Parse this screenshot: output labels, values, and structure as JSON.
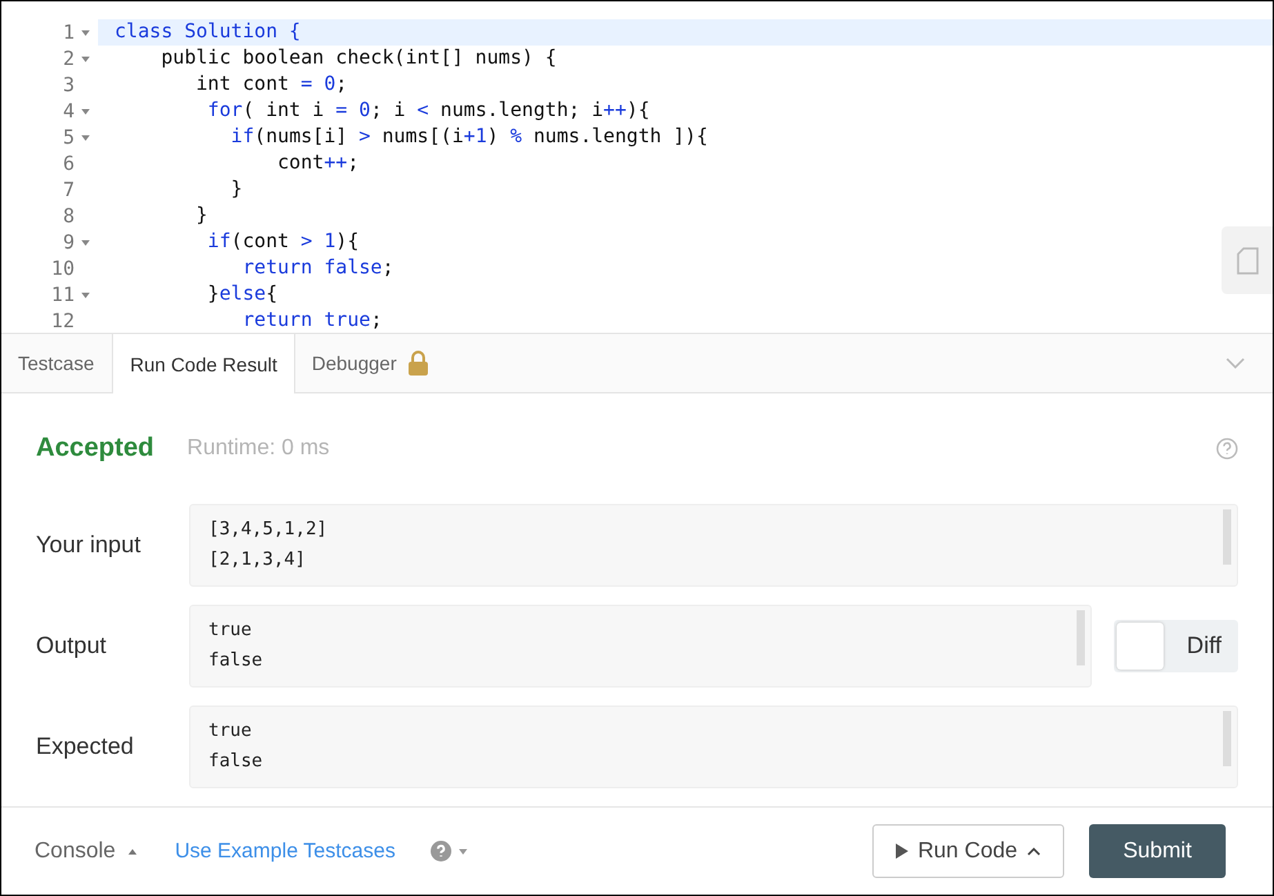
{
  "editor": {
    "lines": [
      {
        "number": "1",
        "foldable": true,
        "active": true,
        "tokens": [
          {
            "text": "class Solution {",
            "kind": "keyword"
          }
        ]
      },
      {
        "number": "2",
        "foldable": true,
        "active": false,
        "tokens": [
          {
            "text": "    public boolean check(int[] nums) {",
            "kind": "plain"
          }
        ]
      },
      {
        "number": "3",
        "foldable": false,
        "active": false,
        "tokens": [
          {
            "text": "       int cont ",
            "kind": "plain"
          },
          {
            "text": "= 0",
            "kind": "keyword"
          },
          {
            "text": ";",
            "kind": "plain"
          }
        ]
      },
      {
        "number": "4",
        "foldable": true,
        "active": false,
        "tokens": [
          {
            "text": "        for",
            "kind": "keyword"
          },
          {
            "text": "( int i ",
            "kind": "plain"
          },
          {
            "text": "= 0",
            "kind": "keyword"
          },
          {
            "text": "; i ",
            "kind": "plain"
          },
          {
            "text": "<",
            "kind": "keyword"
          },
          {
            "text": " nums.length; i",
            "kind": "plain"
          },
          {
            "text": "++",
            "kind": "keyword"
          },
          {
            "text": "){",
            "kind": "plain"
          }
        ]
      },
      {
        "number": "5",
        "foldable": true,
        "active": false,
        "tokens": [
          {
            "text": "          if",
            "kind": "keyword"
          },
          {
            "text": "(nums[i] ",
            "kind": "plain"
          },
          {
            "text": ">",
            "kind": "keyword"
          },
          {
            "text": " nums[(i",
            "kind": "plain"
          },
          {
            "text": "+1",
            "kind": "keyword"
          },
          {
            "text": ") ",
            "kind": "plain"
          },
          {
            "text": "%",
            "kind": "keyword"
          },
          {
            "text": " nums.length ]){",
            "kind": "plain"
          }
        ]
      },
      {
        "number": "6",
        "foldable": false,
        "active": false,
        "tokens": [
          {
            "text": "              cont",
            "kind": "plain"
          },
          {
            "text": "++",
            "kind": "keyword"
          },
          {
            "text": ";",
            "kind": "plain"
          }
        ]
      },
      {
        "number": "7",
        "foldable": false,
        "active": false,
        "tokens": [
          {
            "text": "          }",
            "kind": "plain"
          }
        ]
      },
      {
        "number": "8",
        "foldable": false,
        "active": false,
        "tokens": [
          {
            "text": "       }",
            "kind": "plain"
          }
        ]
      },
      {
        "number": "9",
        "foldable": true,
        "active": false,
        "tokens": [
          {
            "text": "        if",
            "kind": "keyword"
          },
          {
            "text": "(cont ",
            "kind": "plain"
          },
          {
            "text": "> 1",
            "kind": "keyword"
          },
          {
            "text": "){",
            "kind": "plain"
          }
        ]
      },
      {
        "number": "10",
        "foldable": false,
        "active": false,
        "tokens": [
          {
            "text": "           return false",
            "kind": "keyword"
          },
          {
            "text": ";",
            "kind": "plain"
          }
        ]
      },
      {
        "number": "11",
        "foldable": true,
        "active": false,
        "tokens": [
          {
            "text": "        }",
            "kind": "plain"
          },
          {
            "text": "else",
            "kind": "keyword"
          },
          {
            "text": "{",
            "kind": "plain"
          }
        ]
      },
      {
        "number": "12",
        "foldable": false,
        "active": false,
        "tokens": [
          {
            "text": "           return true",
            "kind": "keyword"
          },
          {
            "text": ";",
            "kind": "plain"
          }
        ]
      }
    ]
  },
  "tabs": [
    {
      "label": "Testcase",
      "selected": false,
      "locked": false
    },
    {
      "label": "Run Code Result",
      "selected": true,
      "locked": false
    },
    {
      "label": "Debugger",
      "selected": false,
      "locked": true
    }
  ],
  "result": {
    "status": "Accepted",
    "kind": "accepted",
    "runtime": "Runtime: 0 ms",
    "rows": [
      {
        "label": "Your input",
        "lines": [
          "[3,4,5,1,2]",
          "[2,1,3,4]"
        ]
      },
      {
        "label": "Output",
        "lines": [
          "true",
          "false"
        ]
      },
      {
        "label": "Expected",
        "lines": [
          "true",
          "false"
        ]
      }
    ],
    "diff": {
      "label": "Diff",
      "on": false
    }
  },
  "footer": {
    "console": "Console",
    "example_link": "Use Example Testcases",
    "run_code": "Run Code",
    "submit": "Submit"
  }
}
